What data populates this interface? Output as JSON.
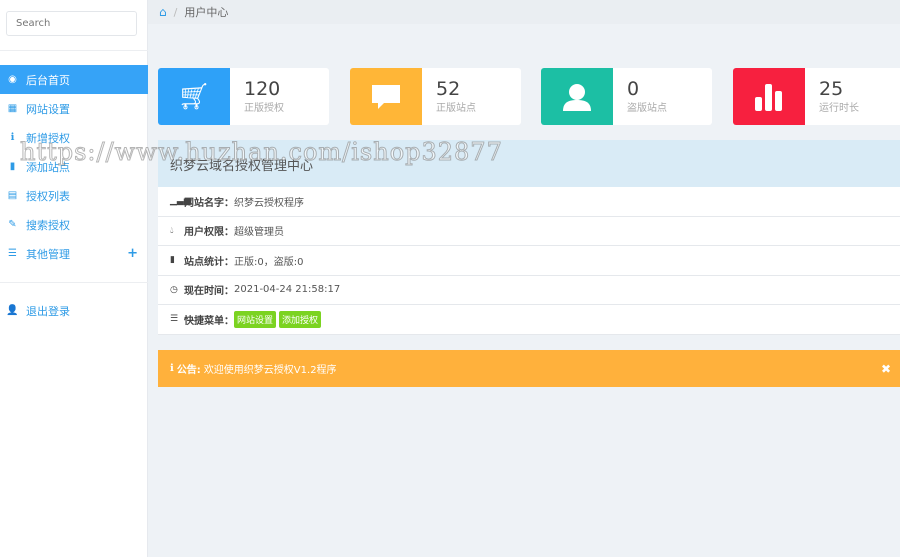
{
  "sidebar": {
    "search_placeholder": "Search",
    "items": [
      {
        "label": "后台首页",
        "icon": "dashboard-icon"
      },
      {
        "label": "网站设置",
        "icon": "grid-icon"
      },
      {
        "label": "新增授权",
        "icon": "info-icon"
      },
      {
        "label": "添加站点",
        "icon": "bar-chart-icon"
      },
      {
        "label": "授权列表",
        "icon": "list-box-icon"
      },
      {
        "label": "搜索授权",
        "icon": "pencil-icon"
      },
      {
        "label": "其他管理",
        "icon": "list-icon"
      }
    ],
    "logout": "退出登录"
  },
  "breadcrumb": {
    "current": "用户中心"
  },
  "stats": [
    {
      "value": "120",
      "label": "正版授权",
      "color": "#2ea1f8",
      "icon": "cart-icon"
    },
    {
      "value": "52",
      "label": "正版站点",
      "color": "#ffb637",
      "icon": "comment-icon"
    },
    {
      "value": "0",
      "label": "盗版站点",
      "color": "#1cbfa4",
      "icon": "user-icon"
    },
    {
      "value": "25",
      "label": "运行时长",
      "color": "#f7203f",
      "icon": "bar-chart-icon"
    }
  ],
  "panel": {
    "title": "织梦云域名授权管理中心",
    "rows": [
      {
        "key": "网站名字：",
        "value": "织梦云授权程序"
      },
      {
        "key": "用户权限：",
        "value": "超级管理员"
      },
      {
        "key": "站点统计：",
        "value": "正版:0，盗版:0"
      },
      {
        "key": "现在时间：",
        "value": "2021-04-24 21:58:17"
      },
      {
        "key": "快捷菜单：",
        "tags": [
          "网站设置",
          "添加授权"
        ]
      }
    ]
  },
  "notice": {
    "label": "公告:",
    "text": "欢迎使用织梦云授权V1.2程序"
  },
  "watermark": "https://www.huzhan.com/ishop32877"
}
